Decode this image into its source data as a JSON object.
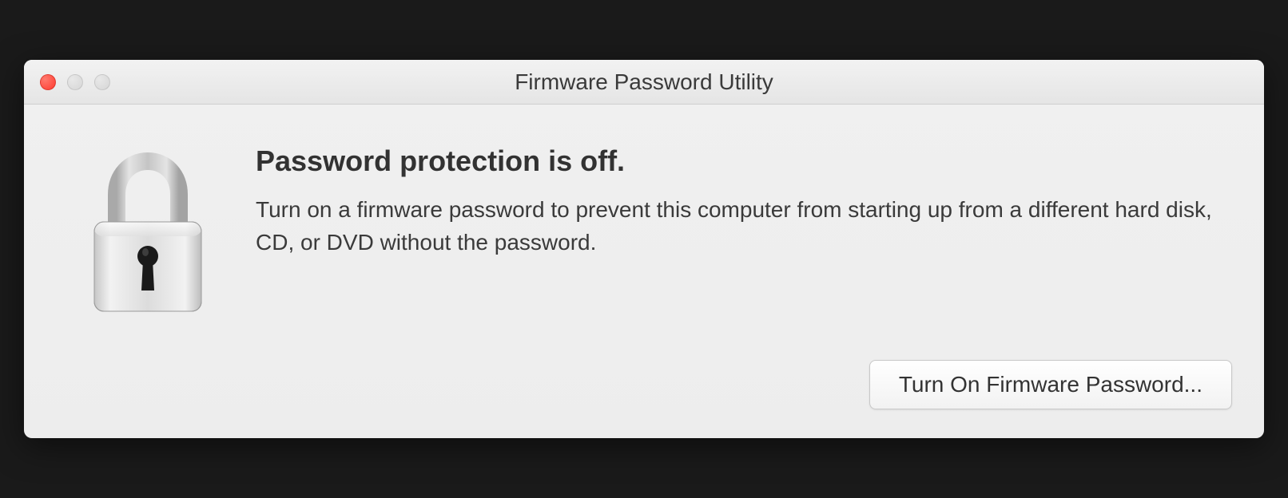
{
  "window": {
    "title": "Firmware Password Utility"
  },
  "content": {
    "heading": "Password protection is off.",
    "description": "Turn on a firmware password to prevent this computer from starting up from a different hard disk, CD, or DVD without the password."
  },
  "buttons": {
    "turn_on": "Turn On Firmware Password..."
  }
}
